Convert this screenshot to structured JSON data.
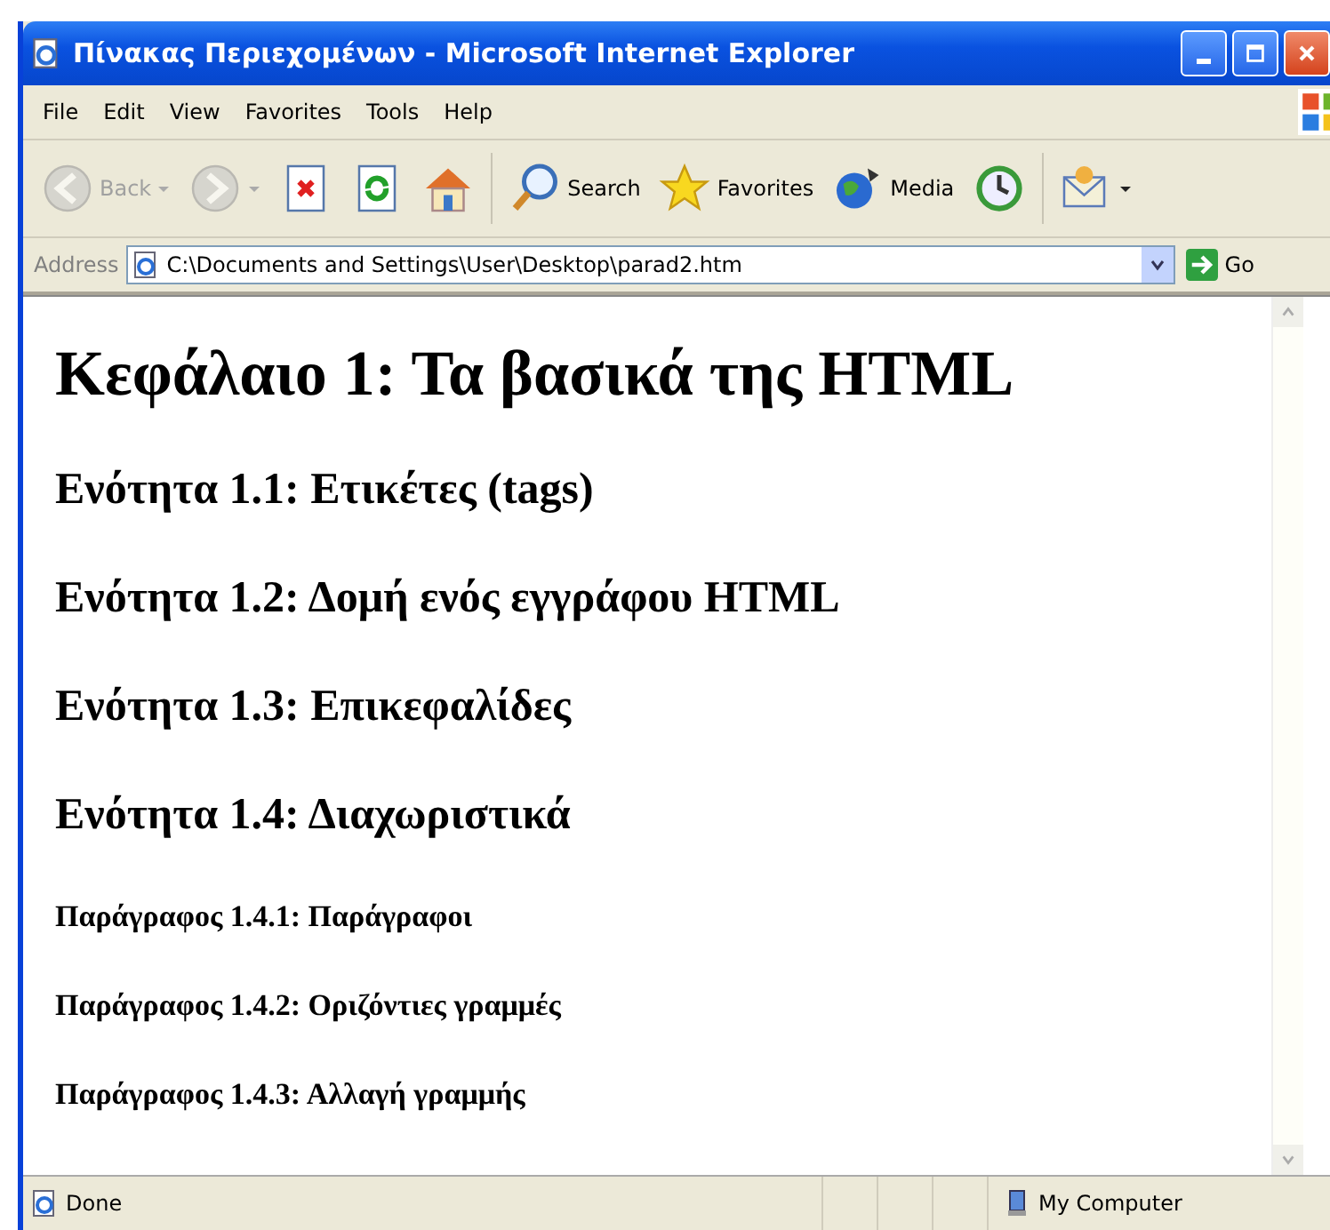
{
  "window": {
    "title": "Πίνακας Περιεχομένων - Microsoft Internet Explorer"
  },
  "menu": [
    "File",
    "Edit",
    "View",
    "Favorites",
    "Tools",
    "Help"
  ],
  "toolbar": [
    {
      "kind": "back",
      "label": "Back",
      "disabled": true
    },
    {
      "kind": "forward",
      "disabled": true
    },
    {
      "kind": "stop",
      "disabled": false
    },
    {
      "kind": "refresh",
      "disabled": false
    },
    {
      "kind": "home",
      "disabled": false
    },
    {
      "kind": "search",
      "label": "Search",
      "disabled": false
    },
    {
      "kind": "favorites",
      "label": "Favorites",
      "disabled": false
    },
    {
      "kind": "media",
      "label": "Media",
      "disabled": false
    },
    {
      "kind": "history",
      "disabled": false
    },
    {
      "kind": "mail",
      "disabled": false
    }
  ],
  "address": {
    "label": "Address",
    "value": "C:\\Documents and Settings\\User\\Desktop\\parad2.htm",
    "go": "Go"
  },
  "document": [
    {
      "kind": "h1",
      "text": "Κεφάλαιο 1: Τα βασικά της HTML"
    },
    {
      "kind": "h2",
      "text": "Ενότητα 1.1: Ετικέτες (tags)"
    },
    {
      "kind": "h2",
      "text": "Ενότητα 1.2: Δομή ενός εγγράφου HTML"
    },
    {
      "kind": "h2",
      "text": "Ενότητα 1.3: Επικεφαλίδες"
    },
    {
      "kind": "h2",
      "text": "Ενότητα 1.4: Διαχωριστικά"
    },
    {
      "kind": "h4",
      "text": "Παράγραφος 1.4.1: Παράγραφοι"
    },
    {
      "kind": "h4",
      "text": "Παράγραφος 1.4.2: Οριζόντιες γραμμές"
    },
    {
      "kind": "h4",
      "text": "Παράγραφος 1.4.3: Αλλαγή γραμμής"
    }
  ],
  "status_bar": {
    "text": "Done",
    "zone": "My Computer"
  }
}
